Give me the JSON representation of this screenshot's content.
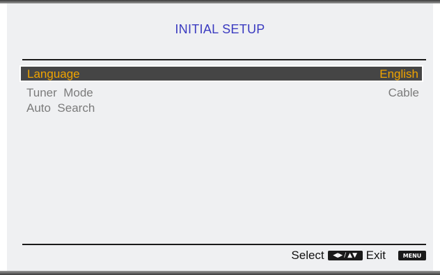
{
  "title": "INITIAL SETUP",
  "menu_items": [
    {
      "label": "Language",
      "value": "English",
      "selected": true
    },
    {
      "label": "Tuner  Mode",
      "value": "Cable",
      "selected": false
    },
    {
      "label": "Auto  Search",
      "value": "",
      "selected": false
    }
  ],
  "footer": {
    "select_label": "Select",
    "exit_label": "Exit",
    "menu_key_label": "MENU",
    "select_icon": "left-right-up-down-arrows-icon",
    "menu_icon": "menu-key-icon"
  },
  "colors": {
    "title": "#3a3ac0",
    "selected_text": "#f0a400",
    "selected_background": "#454545",
    "item_text": "#7b7b7b",
    "panel_background": "#eff0f2"
  }
}
